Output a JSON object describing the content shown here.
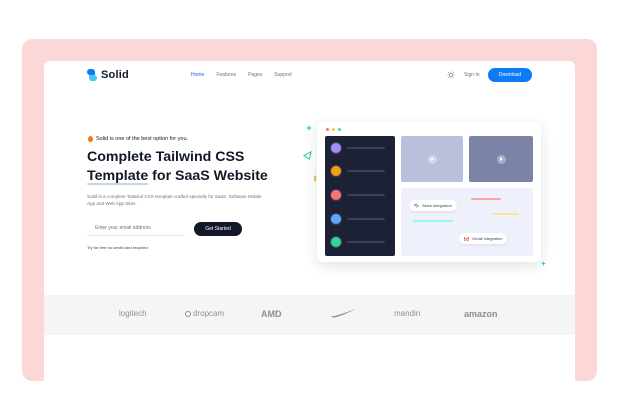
{
  "header": {
    "logo_text": "Solid",
    "nav": [
      "Home",
      "Features",
      "Pages",
      "Support"
    ],
    "active_nav": "Home",
    "theme_icon": "sun-icon",
    "signin_label": "Sign In",
    "download_label": "Download"
  },
  "hero": {
    "tagline": "Solid is one of the best option for you.",
    "headline_line1": "Complete Tailwind CSS",
    "headline_line2_a": "Template",
    "headline_line2_b": " for SaaS Website",
    "description": "Solid is a complete Tailwind CSS template crafted specially for SaaS, Software Mobile App and Web App Sites.",
    "email_placeholder": "Enter your email address",
    "cta_label": "Get Started",
    "note": "Try for free no credit card required."
  },
  "mockup": {
    "chips": {
      "slack": "Slack Integration",
      "gmail": "Gmail Integration"
    },
    "colors": {
      "dot_red": "#f87171",
      "dot_yellow": "#facc15",
      "dot_green": "#4ade80"
    }
  },
  "logos": {
    "items": [
      "logitech",
      "dropcam",
      "AMD",
      "nike",
      "mandin",
      "amazon"
    ]
  },
  "colors": {
    "accent": "#0e7bf6",
    "frame": "#fbd7d7",
    "dark": "#111827"
  }
}
